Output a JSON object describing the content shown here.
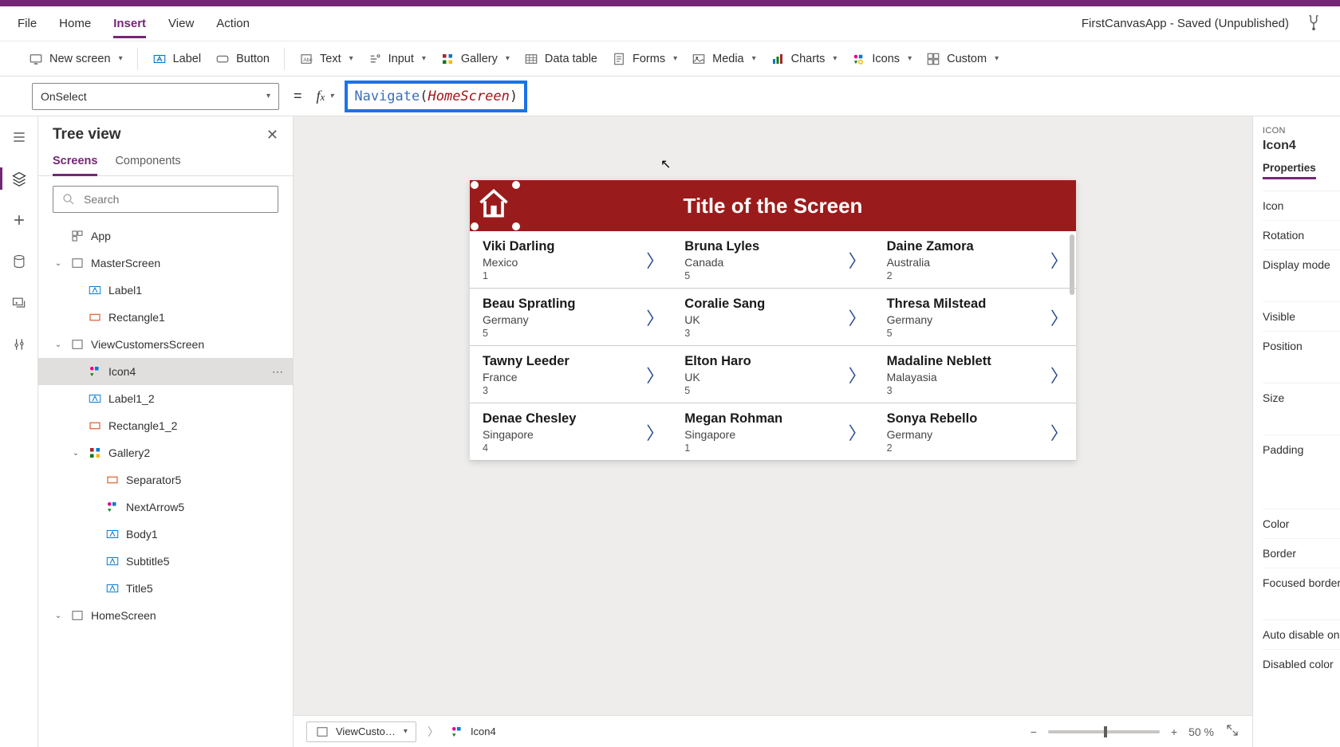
{
  "app_status": "FirstCanvasApp - Saved (Unpublished)",
  "menu": {
    "file": "File",
    "home": "Home",
    "insert": "Insert",
    "view": "View",
    "action": "Action"
  },
  "ribbon": {
    "new_screen": "New screen",
    "label": "Label",
    "button": "Button",
    "text": "Text",
    "input": "Input",
    "gallery": "Gallery",
    "data_table": "Data table",
    "forms": "Forms",
    "media": "Media",
    "charts": "Charts",
    "icons": "Icons",
    "custom": "Custom"
  },
  "formula": {
    "property": "OnSelect",
    "fn": "Navigate",
    "arg": "HomeScreen"
  },
  "tree": {
    "title": "Tree view",
    "tab_screens": "Screens",
    "tab_components": "Components",
    "search_placeholder": "Search",
    "app": "App",
    "master": "MasterScreen",
    "label1": "Label1",
    "rect1": "Rectangle1",
    "viewcust": "ViewCustomersScreen",
    "icon4": "Icon4",
    "label1_2": "Label1_2",
    "rect1_2": "Rectangle1_2",
    "gallery2": "Gallery2",
    "sep5": "Separator5",
    "next5": "NextArrow5",
    "body1": "Body1",
    "sub5": "Subtitle5",
    "title5": "Title5",
    "homescreen": "HomeScreen"
  },
  "screen": {
    "title": "Title of the Screen",
    "cells": [
      {
        "name": "Viki  Darling",
        "sub": "Mexico",
        "num": "1"
      },
      {
        "name": "Bruna  Lyles",
        "sub": "Canada",
        "num": "5"
      },
      {
        "name": "Daine  Zamora",
        "sub": "Australia",
        "num": "2"
      },
      {
        "name": "Beau  Spratling",
        "sub": "Germany",
        "num": "5"
      },
      {
        "name": "Coralie  Sang",
        "sub": "UK",
        "num": "3"
      },
      {
        "name": "Thresa  Milstead",
        "sub": "Germany",
        "num": "5"
      },
      {
        "name": "Tawny  Leeder",
        "sub": "France",
        "num": "3"
      },
      {
        "name": "Elton  Haro",
        "sub": "UK",
        "num": "5"
      },
      {
        "name": "Madaline  Neblett",
        "sub": "Malayasia",
        "num": "3"
      },
      {
        "name": "Denae  Chesley",
        "sub": "Singapore",
        "num": "4"
      },
      {
        "name": "Megan  Rohman",
        "sub": "Singapore",
        "num": "1"
      },
      {
        "name": "Sonya  Rebello",
        "sub": "Germany",
        "num": "2"
      }
    ]
  },
  "footer": {
    "crumb_screen": "ViewCusto…",
    "crumb_control": "Icon4",
    "zoom_value": "50",
    "zoom_unit": "%"
  },
  "right": {
    "group": "ICON",
    "name": "Icon4",
    "tab": "Properties",
    "rows": {
      "icon": "Icon",
      "rotation": "Rotation",
      "display_mode": "Display mode",
      "visible": "Visible",
      "position": "Position",
      "size": "Size",
      "padding": "Padding",
      "color": "Color",
      "border": "Border",
      "focused_border": "Focused border",
      "auto_disable": "Auto disable on s",
      "disabled_color": "Disabled color"
    }
  }
}
